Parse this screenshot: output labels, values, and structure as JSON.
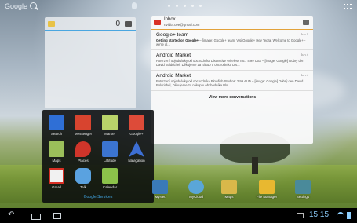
{
  "topbar": {
    "search_label": "Google"
  },
  "mail_widget": {
    "count": "0"
  },
  "gmail": {
    "title": "Inbox",
    "account": "nvidia.cee@gmail.com",
    "conversations": [
      {
        "sender": "Google+ team",
        "date": "Jun 1",
        "subject": "Getting started on Google+",
        "body": " – [image: Google+ team] VisitGoogle+ Hey Tegra, Welcome to Google+ - we're gl..."
      },
      {
        "sender": "Android Market",
        "date": "Jun 4",
        "subject": "",
        "body": "Potvrzení objednávky od obchodníka Distinctive Wireless Inc.: 4,99 US$ – [image: Google] Dobrý den David Boldrichel, Děkujeme za nákup u obchodníka Dis..."
      },
      {
        "sender": "Android Market",
        "date": "Jun 4",
        "subject": "",
        "body": "Potvrzení objednávky od obchodníka Blowfish Studios: 2,99 AUD – [image: Google] Dobrý den David Boldrichel, Děkujeme za nákup u obchodníka Blo..."
      }
    ],
    "view_more": "View more conversations"
  },
  "folder": {
    "name": "Google Services",
    "apps": [
      {
        "label": "Search",
        "icon": "search-app-icon",
        "color": "#2f6fd6"
      },
      {
        "label": "Messenger",
        "icon": "messenger-icon",
        "color": "#d8442f"
      },
      {
        "label": "Market",
        "icon": "market-icon",
        "color": "#b9d46a"
      },
      {
        "label": "Google+",
        "icon": "google-plus-icon",
        "color": "#dd4b39"
      },
      {
        "label": "Maps",
        "icon": "maps-icon",
        "color": "#9bbf5a"
      },
      {
        "label": "Places",
        "icon": "places-icon",
        "color": "#d0352a"
      },
      {
        "label": "Latitude",
        "icon": "latitude-icon",
        "color": "#3b74d0"
      },
      {
        "label": "Navigation",
        "icon": "navigation-icon",
        "color": "#3d6fd4"
      },
      {
        "label": "Gmail",
        "icon": "gmail-icon",
        "color": "#f1f1f1"
      },
      {
        "label": "Talk",
        "icon": "talk-icon",
        "color": "#5aa2e0"
      },
      {
        "label": "Calendar",
        "icon": "calendar-icon",
        "color": "#8bc34a"
      }
    ]
  },
  "desktop": [
    {
      "label": "MyNet",
      "icon": "mynet-icon",
      "color": "#3a7ab8"
    },
    {
      "label": "MyCloud",
      "icon": "mycloud-icon",
      "color": "#5aa6d8"
    },
    {
      "label": "Maps",
      "icon": "maps-icon",
      "color": "#d9b84a"
    },
    {
      "label": "File Manager",
      "icon": "folder-icon",
      "color": "#e8b830"
    },
    {
      "label": "Settings",
      "icon": "settings-icon",
      "color": "#4a8a9a"
    }
  ],
  "status": {
    "time": "15:15"
  }
}
